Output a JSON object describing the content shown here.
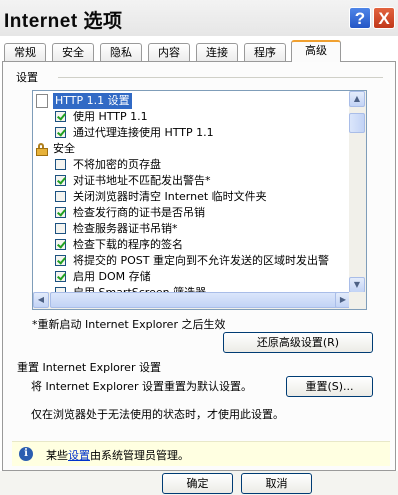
{
  "window": {
    "title": "Internet 选项",
    "help_label": "?",
    "close_label": "X"
  },
  "tabs": [
    {
      "label": "常规"
    },
    {
      "label": "安全"
    },
    {
      "label": "隐私"
    },
    {
      "label": "内容"
    },
    {
      "label": "连接"
    },
    {
      "label": "程序"
    },
    {
      "label": "高级",
      "active": true
    }
  ],
  "settings_group": {
    "label": "设置",
    "items": [
      {
        "type": "header",
        "icon": "page-icon",
        "text": "HTTP 1.1 设置",
        "selected": true
      },
      {
        "type": "checkbox",
        "checked": true,
        "text": "使用 HTTP 1.1"
      },
      {
        "type": "checkbox",
        "checked": true,
        "text": "通过代理连接使用 HTTP 1.1"
      },
      {
        "type": "header",
        "icon": "lock-icon",
        "text": "安全"
      },
      {
        "type": "checkbox",
        "checked": false,
        "text": "不将加密的页存盘"
      },
      {
        "type": "checkbox",
        "checked": true,
        "text": "对证书地址不匹配发出警告*"
      },
      {
        "type": "checkbox",
        "checked": false,
        "text": "关闭浏览器时清空 Internet 临时文件夹"
      },
      {
        "type": "checkbox",
        "checked": true,
        "text": "检查发行商的证书是否吊销"
      },
      {
        "type": "checkbox",
        "checked": false,
        "text": "检查服务器证书吊销*"
      },
      {
        "type": "checkbox",
        "checked": true,
        "text": "检查下载的程序的签名"
      },
      {
        "type": "checkbox",
        "checked": true,
        "text": "将提交的 POST 重定向到不允许发送的区域时发出警"
      },
      {
        "type": "checkbox",
        "checked": true,
        "text": "启用 DOM 存储"
      },
      {
        "type": "checkbox",
        "checked": false,
        "text": "启用 SmartScreen 筛选器"
      }
    ]
  },
  "restart_note": "*重新启动 Internet Explorer 之后生效",
  "restore_button": "还原高级设置(R)",
  "reset_section": {
    "heading": "重置 Internet Explorer 设置",
    "description": "将 Internet Explorer 设置重置为默认设置。",
    "reset_button": "重置(S)...",
    "warning": "仅在浏览器处于无法使用的状态时，才使用此设置。"
  },
  "infobar": {
    "prefix": "某些",
    "link": "设置",
    "suffix": "由系统管理员管理。"
  },
  "buttons": {
    "ok": "确定",
    "cancel": "取消"
  }
}
